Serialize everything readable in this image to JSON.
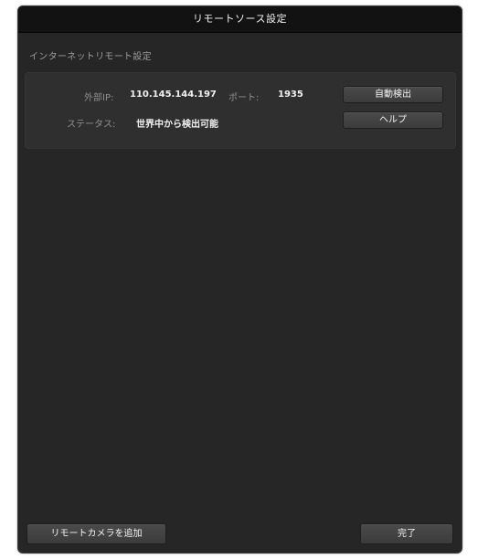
{
  "dialog": {
    "title": "リモートソース設定",
    "section_title": "インターネットリモート設定"
  },
  "remote": {
    "external_ip_label": "外部IP:",
    "external_ip_value": "110.145.144.197",
    "port_label": "ポート:",
    "port_value": "1935",
    "status_label": "ステータス:",
    "status_value": "世界中から検出可能",
    "autodetect_label": "自動検出",
    "help_label": "ヘルプ"
  },
  "footer": {
    "add_camera_label": "リモートカメラを追加",
    "done_label": "完了"
  },
  "colors": {
    "dialog_bg": "#262626",
    "titlebar_bg": "#121212",
    "panel_bg": "#2f2f2f",
    "button_bg": "#434343"
  }
}
